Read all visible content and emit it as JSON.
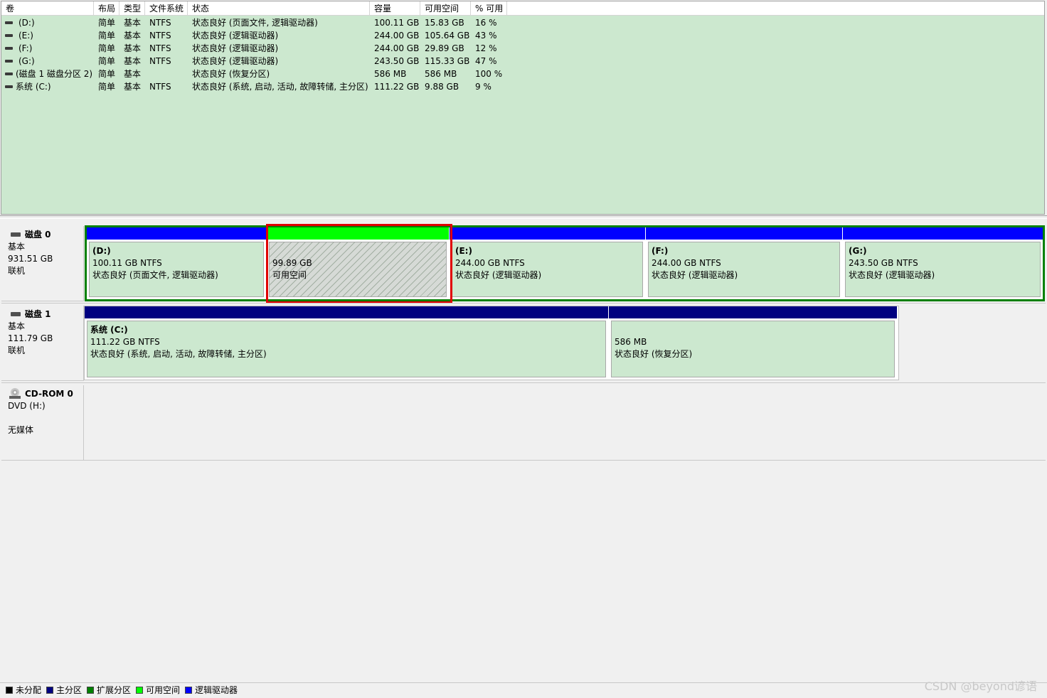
{
  "columns": [
    "卷",
    "布局",
    "类型",
    "文件系统",
    "状态",
    "容量",
    "可用空间",
    "% 可用"
  ],
  "volumes": [
    {
      "name": "(D:)",
      "layout": "简单",
      "type": "基本",
      "fs": "NTFS",
      "status": "状态良好 (页面文件, 逻辑驱动器)",
      "capacity": "100.11 GB",
      "free": "15.83 GB",
      "pct": "16 %"
    },
    {
      "name": "(E:)",
      "layout": "简单",
      "type": "基本",
      "fs": "NTFS",
      "status": "状态良好 (逻辑驱动器)",
      "capacity": "244.00 GB",
      "free": "105.64 GB",
      "pct": "43 %"
    },
    {
      "name": "(F:)",
      "layout": "简单",
      "type": "基本",
      "fs": "NTFS",
      "status": "状态良好 (逻辑驱动器)",
      "capacity": "244.00 GB",
      "free": "29.89 GB",
      "pct": "12 %"
    },
    {
      "name": "(G:)",
      "layout": "简单",
      "type": "基本",
      "fs": "NTFS",
      "status": "状态良好 (逻辑驱动器)",
      "capacity": "243.50 GB",
      "free": "115.33 GB",
      "pct": "47 %"
    },
    {
      "name": "(磁盘 1 磁盘分区 2)",
      "layout": "简单",
      "type": "基本",
      "fs": "",
      "status": "状态良好 (恢复分区)",
      "capacity": "586 MB",
      "free": "586 MB",
      "pct": "100 %"
    },
    {
      "name": "系统 (C:)",
      "layout": "简单",
      "type": "基本",
      "fs": "NTFS",
      "status": "状态良好 (系统, 启动, 活动, 故障转储, 主分区)",
      "capacity": "111.22 GB",
      "free": "9.88 GB",
      "pct": "9 %"
    }
  ],
  "disks": [
    {
      "title": "磁盘 0",
      "type": "基本",
      "size": "931.51 GB",
      "state": "联机",
      "partitions": [
        {
          "name": "(D:)",
          "size": "100.11 GB NTFS",
          "status": "状态良好 (页面文件, 逻辑驱动器)"
        },
        {
          "name": "",
          "size": "99.89 GB",
          "status": "可用空间"
        },
        {
          "name": "(E:)",
          "size": "244.00 GB NTFS",
          "status": "状态良好 (逻辑驱动器)"
        },
        {
          "name": "(F:)",
          "size": "244.00 GB NTFS",
          "status": "状态良好 (逻辑驱动器)"
        },
        {
          "name": "(G:)",
          "size": "243.50 GB NTFS",
          "status": "状态良好 (逻辑驱动器)"
        }
      ]
    },
    {
      "title": "磁盘 1",
      "type": "基本",
      "size": "111.79 GB",
      "state": "联机",
      "partitions": [
        {
          "name": "系统  (C:)",
          "size": "111.22 GB NTFS",
          "status": "状态良好 (系统, 启动, 活动, 故障转储, 主分区)"
        },
        {
          "name": "",
          "size": "586 MB",
          "status": "状态良好 (恢复分区)"
        }
      ]
    },
    {
      "title": "CD-ROM 0",
      "type": "DVD (H:)",
      "size": "",
      "state": "无媒体"
    }
  ],
  "legend": [
    {
      "label": "未分配",
      "color": "#000000"
    },
    {
      "label": "主分区",
      "color": "#000080"
    },
    {
      "label": "扩展分区",
      "color": "#008000"
    },
    {
      "label": "可用空间",
      "color": "#00ff00"
    },
    {
      "label": "逻辑驱动器",
      "color": "#0000ff"
    }
  ],
  "colors": {
    "logical": "#0000ff",
    "primary": "#000080",
    "free": "#00ff00",
    "extended": "#008000",
    "highlight": "#e00000",
    "volume_bg": "#cce8cf"
  },
  "watermark": "CSDN @beyond谚语"
}
